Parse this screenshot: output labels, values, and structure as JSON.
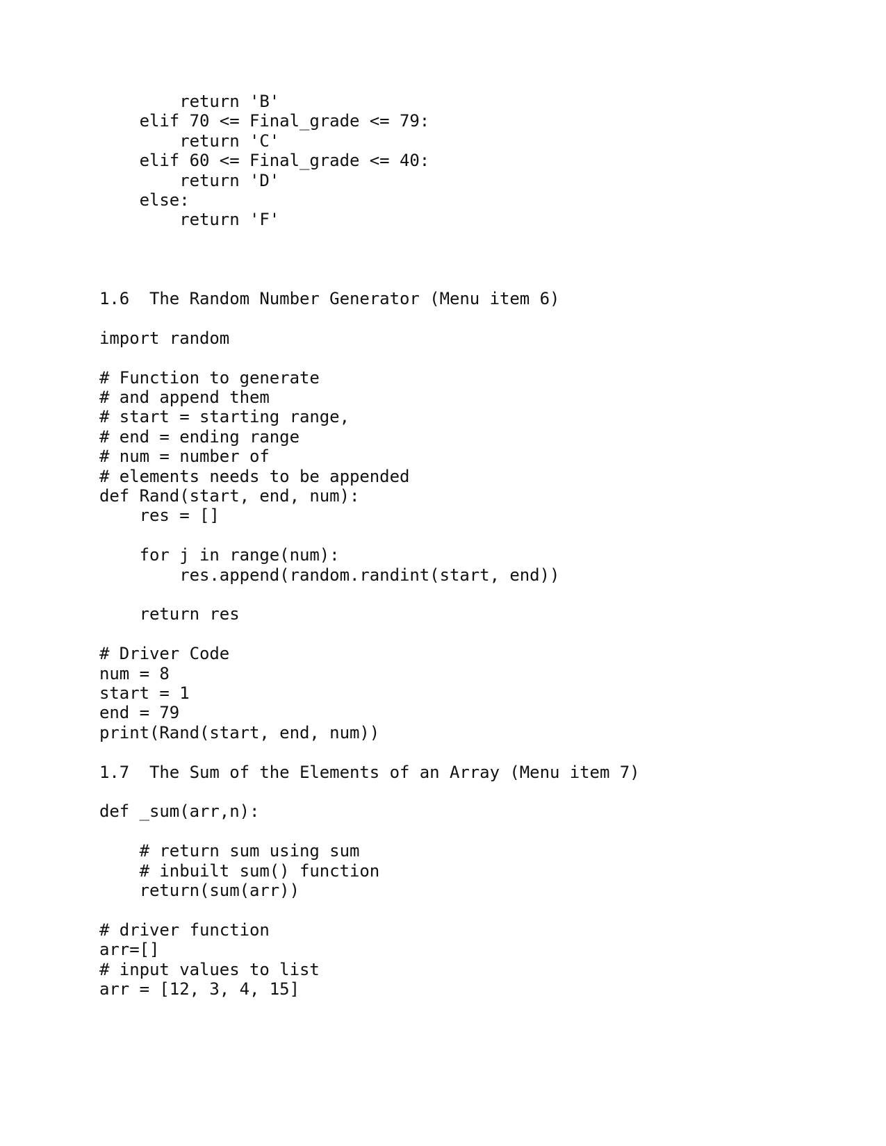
{
  "document": {
    "page_background": "#ffffff",
    "text_color": "#111111",
    "blocks": [
      {
        "id": "grade_function_tail",
        "kind": "code",
        "lines": [
          "        return 'B'",
          "    elif 70 <= Final_grade <= 79:",
          "        return 'C'",
          "    elif 60 <= Final_grade <= 40:",
          "        return 'D'",
          "    else:",
          "        return 'F'"
        ]
      },
      {
        "id": "gap_1",
        "kind": "blank",
        "count": 3
      },
      {
        "id": "heading_1_6",
        "kind": "heading",
        "text": "1.6  The Random Number Generator (Menu item 6)"
      },
      {
        "id": "gap_2",
        "kind": "blank",
        "count": 1
      },
      {
        "id": "import_block",
        "kind": "code",
        "lines": [
          "import random"
        ]
      },
      {
        "id": "gap_3",
        "kind": "blank",
        "count": 1
      },
      {
        "id": "rand_function",
        "kind": "code",
        "lines": [
          "# Function to generate",
          "# and append them",
          "# start = starting range,",
          "# end = ending range",
          "# num = number of",
          "# elements needs to be appended",
          "def Rand(start, end, num):",
          "    res = []",
          "",
          "    for j in range(num):",
          "        res.append(random.randint(start, end))",
          "",
          "    return res"
        ]
      },
      {
        "id": "gap_4",
        "kind": "blank",
        "count": 1
      },
      {
        "id": "rand_driver",
        "kind": "code",
        "lines": [
          "# Driver Code",
          "num = 8",
          "start = 1",
          "end = 79",
          "print(Rand(start, end, num))"
        ]
      },
      {
        "id": "gap_5",
        "kind": "blank",
        "count": 1
      },
      {
        "id": "heading_1_7",
        "kind": "heading",
        "text": "1.7  The Sum of the Elements of an Array (Menu item 7)"
      },
      {
        "id": "gap_6",
        "kind": "blank",
        "count": 1
      },
      {
        "id": "sum_function",
        "kind": "code",
        "lines": [
          "def _sum(arr,n):",
          "",
          "    # return sum using sum",
          "    # inbuilt sum() function",
          "    return(sum(arr))"
        ]
      },
      {
        "id": "gap_7",
        "kind": "blank",
        "count": 1
      },
      {
        "id": "sum_driver",
        "kind": "code",
        "lines": [
          "# driver function",
          "arr=[]",
          "# input values to list",
          "arr = [12, 3, 4, 15]"
        ]
      }
    ]
  }
}
